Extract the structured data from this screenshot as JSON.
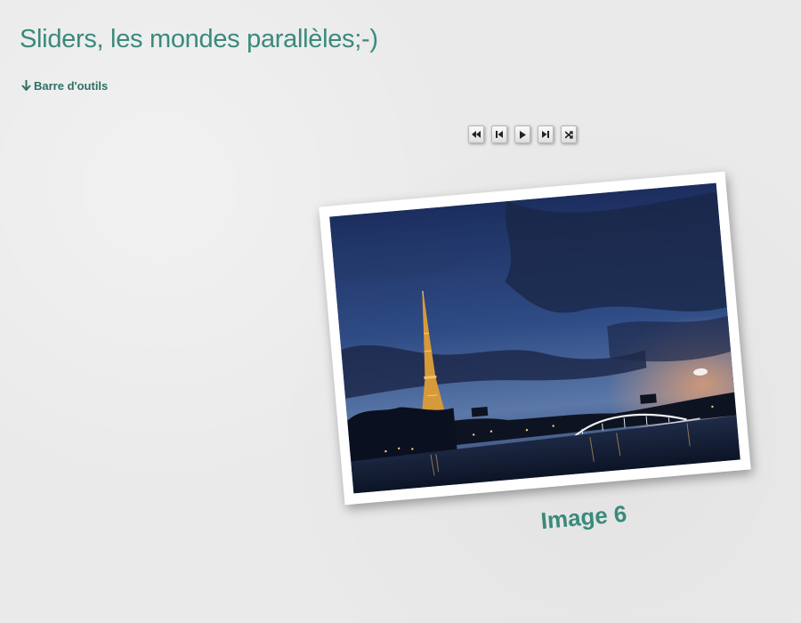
{
  "page": {
    "title": "Sliders, les mondes parallèles;-)",
    "toolbar_link": "Barre d'outils",
    "toolbar_arrow": "🡣"
  },
  "slider": {
    "controls": [
      {
        "name": "first-button",
        "icon": "first-icon"
      },
      {
        "name": "previous-button",
        "icon": "previous-icon"
      },
      {
        "name": "play-button",
        "icon": "play-icon"
      },
      {
        "name": "last-button",
        "icon": "last-icon"
      },
      {
        "name": "shuffle-button",
        "icon": "shuffle-icon"
      }
    ],
    "current_caption": "Image 6",
    "image_description": "Eiffel Tower at dusk over the Seine"
  },
  "colors": {
    "accent": "#3a8a7c",
    "link": "#2f6f64",
    "background": "#eaeaea"
  }
}
